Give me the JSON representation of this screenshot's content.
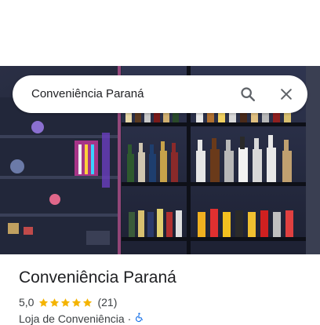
{
  "search": {
    "query": "Conveniência Paraná"
  },
  "place": {
    "name": "Conveniência Paraná",
    "rating": "5,0",
    "stars": 5,
    "review_count": "(21)",
    "category": "Loja de Conveniência",
    "separator": "·"
  },
  "icons": {
    "search": "search-icon",
    "close": "close-icon",
    "star": "star-icon",
    "accessibility": "wheelchair-icon"
  },
  "colors": {
    "star": "#f4b400",
    "accessibility": "#1a73e8"
  }
}
